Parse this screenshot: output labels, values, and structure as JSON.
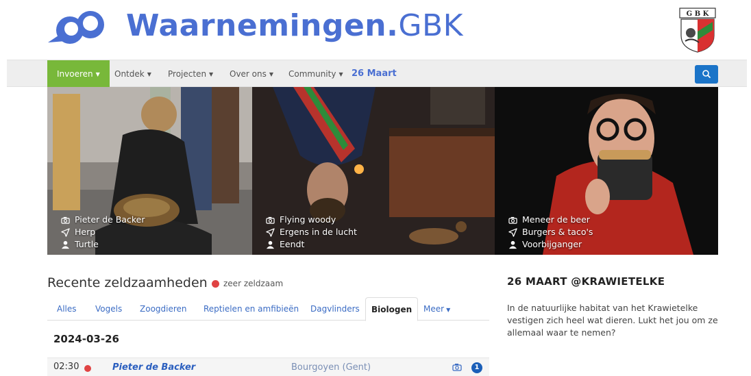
{
  "brand": {
    "name_bold": "Waarnemingen.",
    "name_suffix": "GBK",
    "crest_letters": "G B K",
    "logo_icon": "binoculars-icon"
  },
  "nav": {
    "items": [
      {
        "label": "Invoeren",
        "active": true
      },
      {
        "label": "Ontdek"
      },
      {
        "label": "Projecten"
      },
      {
        "label": "Over ons"
      },
      {
        "label": "Community"
      }
    ],
    "highlight": "26 Maart",
    "search_icon": "search-icon"
  },
  "panels": [
    {
      "observer": "Pieter de Backer",
      "location": "Herp",
      "species": "Turtle"
    },
    {
      "observer": "Flying woody",
      "location": "Ergens in de lucht",
      "species": "Eendt"
    },
    {
      "observer": "Meneer de beer",
      "location": "Burgers & taco's",
      "species": "Voorbijganger"
    }
  ],
  "rarities": {
    "title": "Recente zeldzaamheden",
    "legend": "zeer zeldzaam",
    "tabs": [
      "Alles",
      "Vogels",
      "Zoogdieren",
      "Reptielen en amfibieën",
      "Dagvlinders",
      "Biologen",
      "Meer"
    ],
    "active_tab": "Biologen",
    "date": "2024-03-26",
    "rows": [
      {
        "time": "02:30",
        "observer": "Pieter de Backer",
        "location": "Bourgoyen (Gent)",
        "count": "1"
      }
    ]
  },
  "sidebar": {
    "title": "26 MAART @KRAWIETELKE",
    "text": "In de natuurlijke habitat van het Krawietelke vestigen zich heel wat dieren.  Lukt het jou om ze allemaal waar te nemen?"
  },
  "colors": {
    "brand_blue": "#4a6fd2",
    "nav_active_green": "#78b83a",
    "search_button_blue": "#1b74c8",
    "rarity_red": "#e04343",
    "link_blue": "#2b5fbf"
  }
}
